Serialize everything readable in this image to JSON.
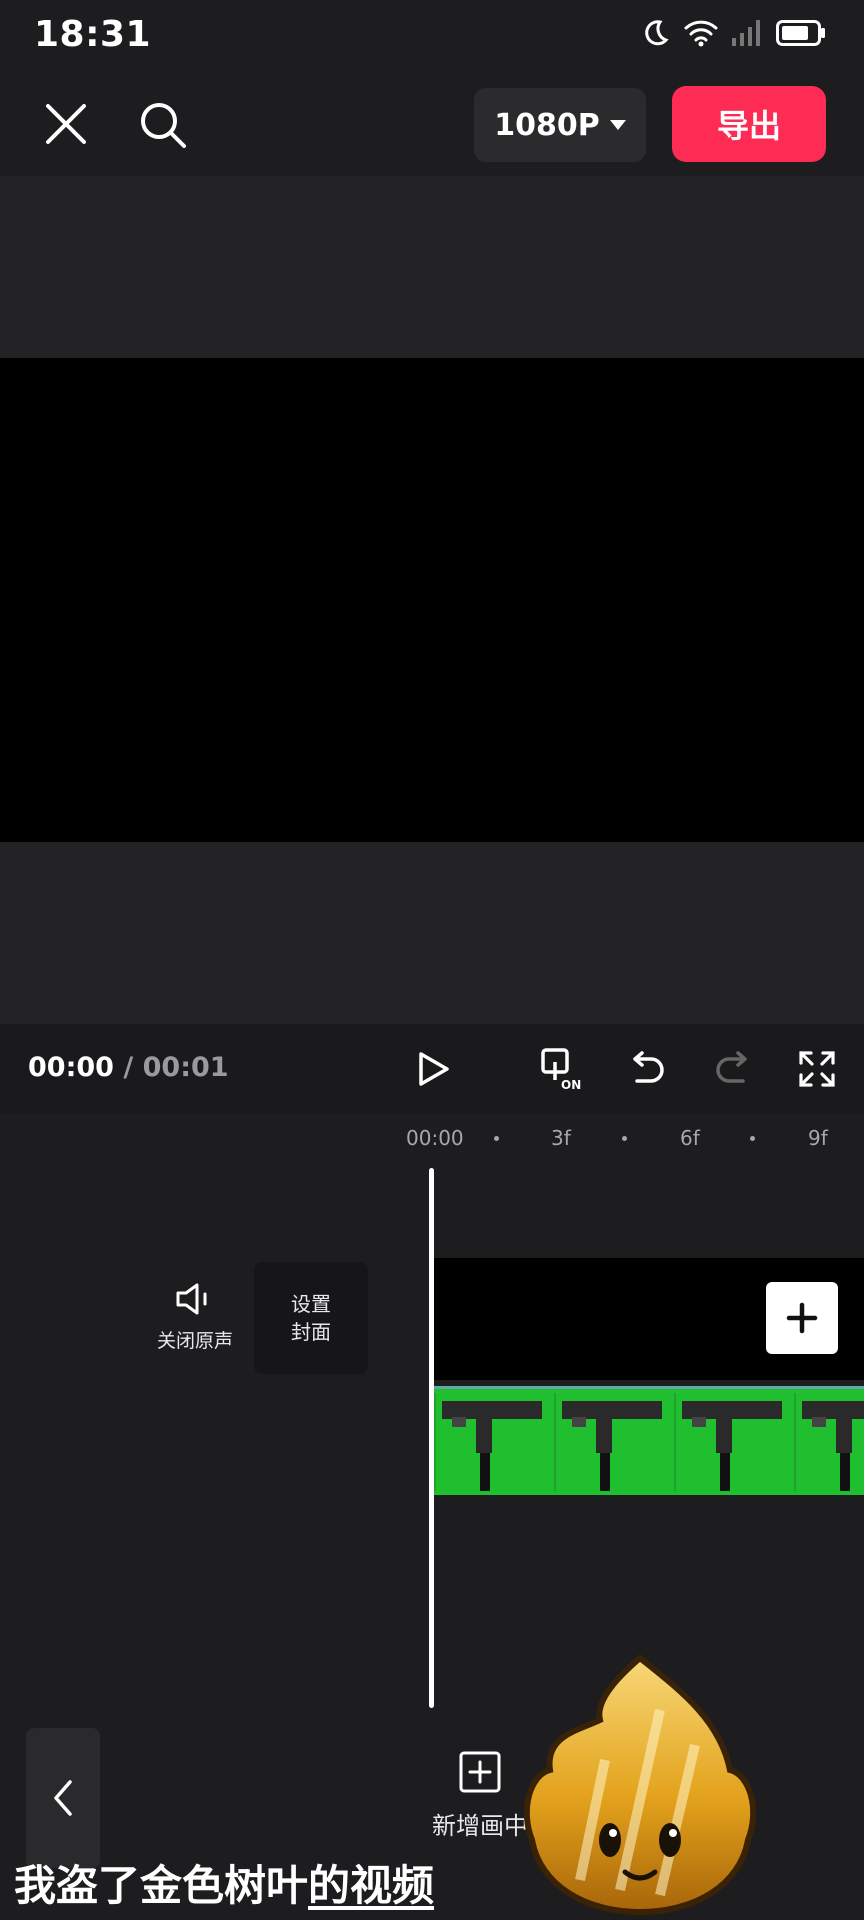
{
  "status_bar": {
    "time": "18:31",
    "icons": [
      "moon-icon",
      "wifi-icon",
      "signal-icon",
      "battery-icon"
    ]
  },
  "toolbar": {
    "close_icon": "close-icon",
    "search_icon": "search-icon",
    "resolution": "1080P",
    "export_label": "导出",
    "export_color": "#fe2c55"
  },
  "controls": {
    "current_time": "00:00",
    "separator": " / ",
    "total_time": "00:01",
    "icons": [
      "play-icon",
      "sync-on-icon",
      "undo-icon",
      "redo-icon",
      "fullscreen-icon"
    ],
    "sync_badge": "ON"
  },
  "ruler": {
    "ticks": [
      "00:00",
      "3f",
      "6f",
      "9f"
    ]
  },
  "timeline": {
    "mute_label": "关闭原声",
    "cover_line1": "设置",
    "cover_line2": "封面"
  },
  "bottom_bar": {
    "add_pip_label": "新增画中"
  },
  "overlay": {
    "caption_plain": "我盗了金色树叶",
    "caption_underlined": "的视频"
  }
}
